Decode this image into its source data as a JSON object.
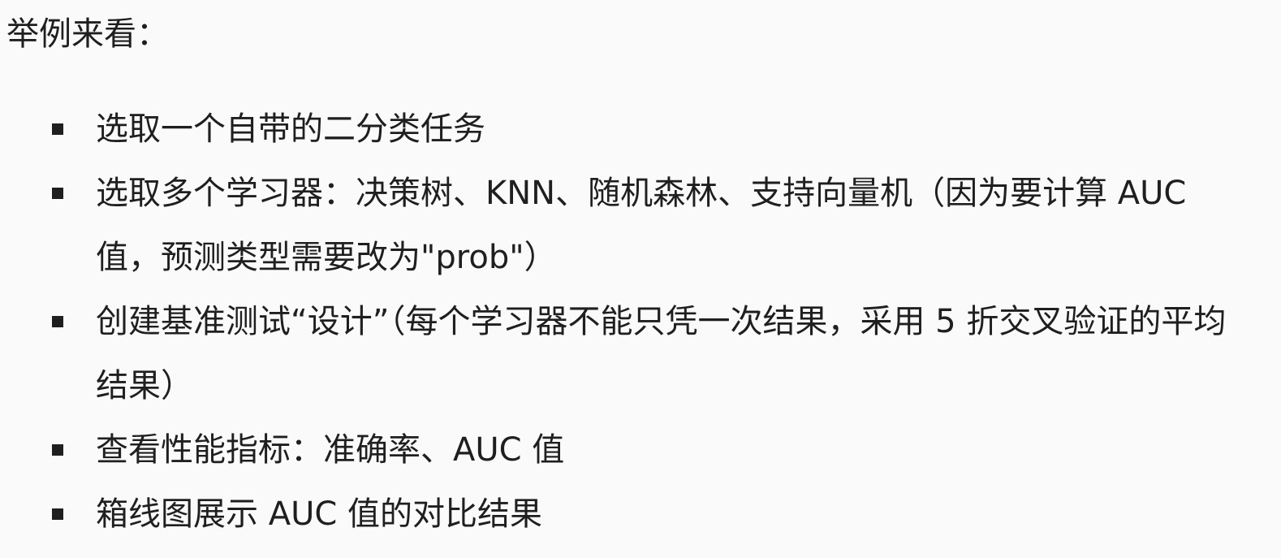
{
  "intro": "举例来看：",
  "bullets": [
    {
      "text": "选取一个自带的二分类任务"
    },
    {
      "text": "选取多个学习器：决策树、KNN、随机森林、支持向量机（因为要计算 AUC 值，预测类型需要改为\"prob\"）"
    },
    {
      "text": "创建基准测试“设计”（每个学习器不能只凭一次结果，采用 5 折交叉验证的平均结果）"
    },
    {
      "text": "查看性能指标：准确率、AUC 值"
    },
    {
      "text": "箱线图展示 AUC 值的对比结果"
    }
  ],
  "colors": {
    "background": "#fafafa",
    "text": "#1f1f1f",
    "bullet": "#1f1f1f"
  },
  "icons": {
    "bullet": "square-bullet-icon"
  }
}
